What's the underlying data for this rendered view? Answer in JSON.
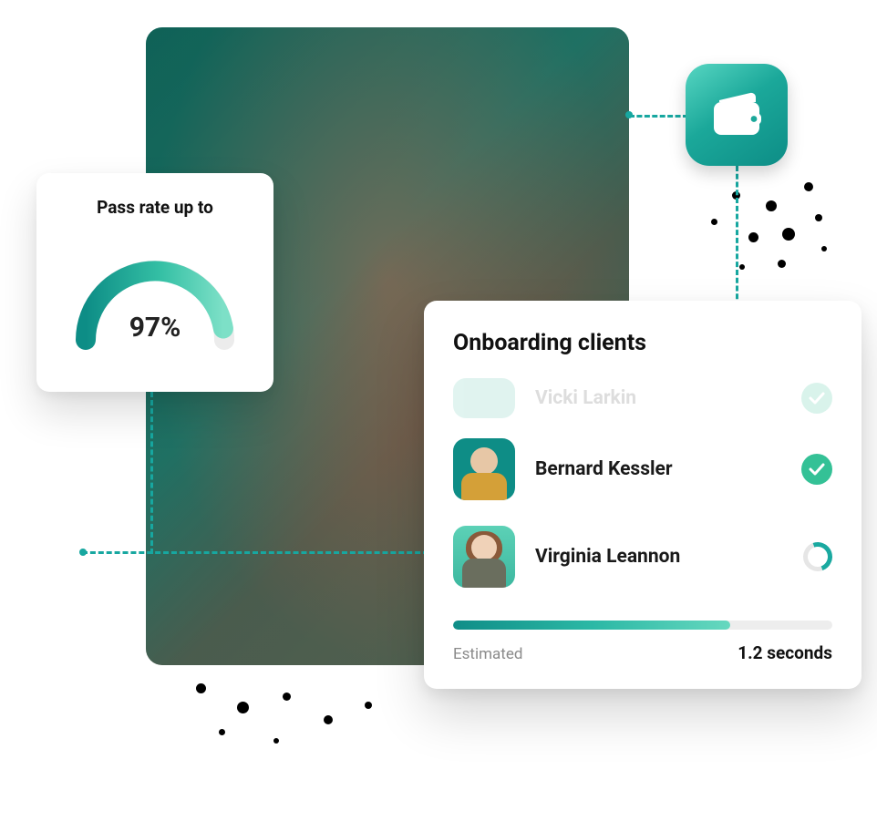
{
  "colors": {
    "accent_start": "#57d6c2",
    "accent_end": "#0d8d86",
    "check_green": "#34c196",
    "connector": "#17a7a0"
  },
  "wallet_tile": {
    "icon": "wallet-icon"
  },
  "pass_rate": {
    "title": "Pass rate up to",
    "value_text": "97%",
    "value_pct": 97
  },
  "onboarding": {
    "title": "Onboarding clients",
    "clients": [
      {
        "name": "Vicki Larkin",
        "status": "done",
        "faded": true
      },
      {
        "name": "Bernard Kessler",
        "status": "done",
        "faded": false
      },
      {
        "name": "Virginia Leannon",
        "status": "loading",
        "faded": false
      }
    ],
    "progress_pct": 73,
    "estimate_label": "Estimated",
    "estimate_value": "1.2 seconds"
  }
}
